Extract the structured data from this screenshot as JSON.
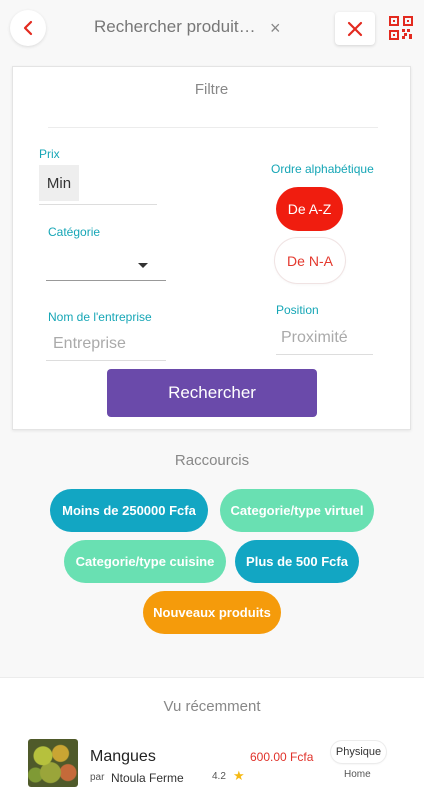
{
  "header": {
    "search_text": "Rechercher produits ...",
    "clear_symbol": "×"
  },
  "filter": {
    "title": "Filtre",
    "prix_label": "Prix",
    "min_value": "Min",
    "categorie_label": "Catégorie",
    "entreprise_label": "Nom de l'entreprise",
    "entreprise_placeholder": "Entreprise",
    "ordre_label": "Ordre alphabétique",
    "az_label": "De A-Z",
    "na_label": "De N-A",
    "position_label": "Position",
    "position_placeholder": "Proximité",
    "search_button": "Rechercher"
  },
  "shortcuts": {
    "title": "Raccourcis",
    "chips": [
      "Moins de 250000 Fcfa",
      "Categorie/type virtuel",
      "Categorie/type cuisine",
      "Plus de 500 Fcfa",
      "Nouveaux produits"
    ]
  },
  "recent": {
    "title": "Vu récemment",
    "product": {
      "name": "Mangues",
      "par": "par",
      "seller": "Ntoula Ferme",
      "price": "600.00 Fcfa",
      "rating": "4.2",
      "type": "Physique",
      "category": "Home"
    }
  },
  "colors": {
    "accent_red": "#f01d0f",
    "teal": "#16a6b6",
    "purple": "#6a4aaa",
    "chip_dark": "#12a6c3",
    "chip_light": "#69e0b2",
    "chip_orange": "#f59b0b"
  },
  "icons": {
    "back": "chevron-left-icon",
    "close": "close-icon",
    "qr": "qr-code-icon",
    "dropdown": "caret-down-icon",
    "star": "star-icon"
  }
}
